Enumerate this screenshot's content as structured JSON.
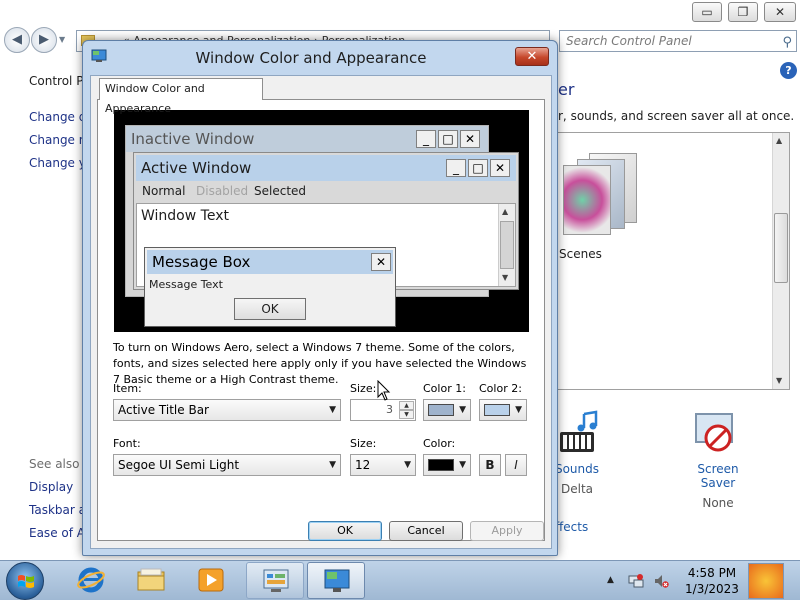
{
  "cp": {
    "caption_min": "▭",
    "caption_max": "❐",
    "caption_close": "✕",
    "nav_back": "◀",
    "nav_forward": "▶",
    "address_text": "« Appearance and Personalization › Personalization",
    "search_placeholder": "Search Control Panel",
    "left_home": "Control Panel Home",
    "left_links": [
      "Change desktop icons",
      "Change mouse pointers",
      "Change your account picture"
    ],
    "see_also": "See also",
    "see_also_links": [
      "Display",
      "Taskbar and Start Menu",
      "Ease of Access Center"
    ],
    "help": "?",
    "heading_fragment": "er",
    "desc_fragment": "r, sounds, and screen saver all at once.",
    "theme_name_fragment": "Scenes",
    "sounds_label": "Sounds",
    "sounds_value": "Delta",
    "screensaver_label": "Screen Saver",
    "screensaver_value": "None",
    "effects_fragment": "ffects"
  },
  "dialog": {
    "title": "Window Color and Appearance",
    "close": "✕",
    "tab_label": "Window Color and Appearance",
    "preview": {
      "inactive_title": "Inactive Window",
      "active_title": "Active Window",
      "btn_min": "_",
      "btn_max": "□",
      "btn_close": "✕",
      "menu_normal": "Normal",
      "menu_disabled": "Disabled",
      "menu_selected": "Selected",
      "window_text": "Window Text",
      "msgbox_title": "Message Box",
      "msgbox_text": "Message Text",
      "msgbox_ok": "OK"
    },
    "info_text": "To turn on Windows Aero, select a Windows 7 theme.  Some of the colors, fonts, and sizes selected here apply only if you have selected the Windows 7 Basic theme or a High Contrast theme.",
    "item_label": "Item:",
    "item_value": "Active Title Bar",
    "item_size_label": "Size:",
    "item_size_value": "3",
    "color1_label": "Color 1:",
    "color1": "#9fb3cc",
    "color2_label": "Color 2:",
    "color2": "#b9d1ea",
    "font_label": "Font:",
    "font_value": "Segoe UI Semi Light",
    "font_size_label": "Size:",
    "font_size_value": "12",
    "font_color_label": "Color:",
    "font_color": "#000000",
    "bold": "B",
    "italic": "I",
    "ok": "OK",
    "cancel": "Cancel",
    "apply": "Apply"
  },
  "taskbar": {
    "tray_arrow": "▲",
    "time": "4:58 PM",
    "date": "1/3/2023"
  },
  "colors": {
    "taskbar": "#a9c2dd",
    "dialog_frame": "#c2d7ee",
    "active_title": "#b9d1ea",
    "inactive_title": "#bfcddb"
  }
}
